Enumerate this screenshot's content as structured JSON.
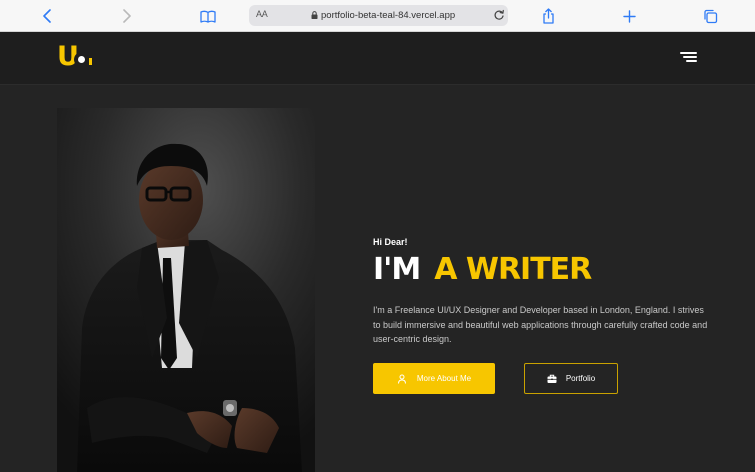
{
  "browser": {
    "text_size_label": "AA",
    "url": "portfolio-beta-teal-84.vercel.app"
  },
  "header": {
    "logo_alt": "Uo logo",
    "menu_icon": "hamburger-menu-icon"
  },
  "hero": {
    "greeting": "Hi Dear!",
    "headline_prefix": "I'M",
    "headline_role": "A WRITER",
    "bio": "I'm a Freelance UI/UX Designer and Developer based in London, England. I strives to build immersive and beautiful web applications through carefully crafted code and user-centric design.",
    "primary_button": "More About Me",
    "secondary_button": "Portfolio",
    "photo_alt": "Portrait of a man in a black suit, white shirt and glasses"
  },
  "colors": {
    "accent": "#f7c600",
    "background": "#242424",
    "header_bg": "#1e1e1e",
    "browser_blue": "#2f7bf6"
  }
}
